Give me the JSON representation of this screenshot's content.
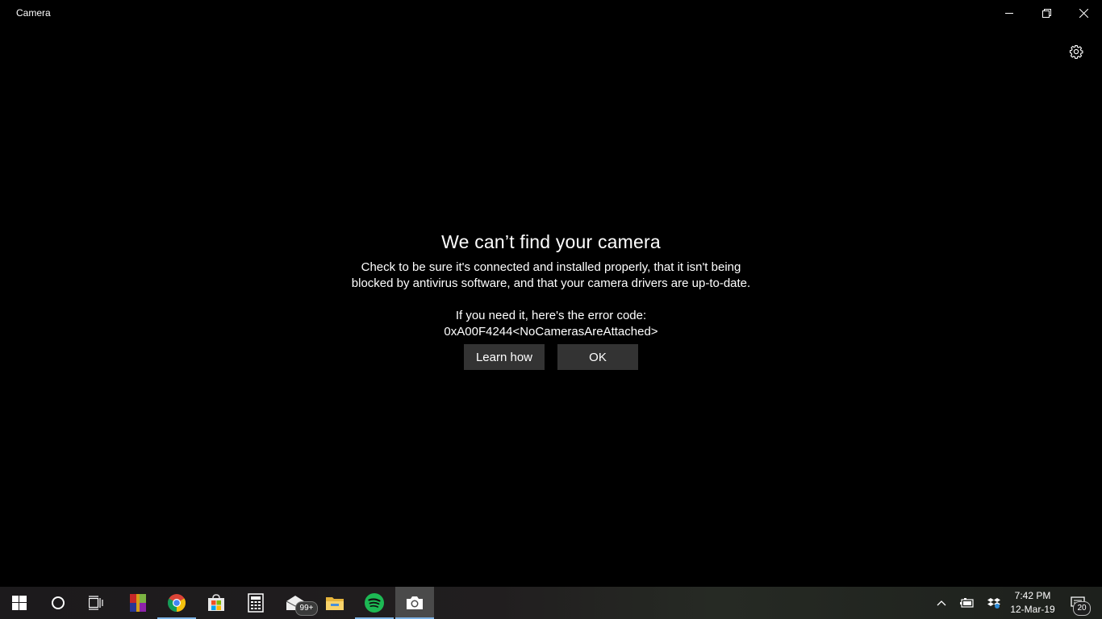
{
  "window": {
    "title": "Camera"
  },
  "dialog": {
    "title": "We can’t find your camera",
    "line1": "Check to be sure it's connected and installed properly, that it isn't being",
    "line2": "blocked by antivirus software, and that your camera drivers are up-to-date.",
    "line3": "If you need it, here's the error code:",
    "line4": "0xA00F4244<NoCamerasAreAttached>",
    "learn_how_label": "Learn how",
    "ok_label": "OK"
  },
  "taskbar": {
    "mail_badge": "99+",
    "clock_time": "7:42 PM",
    "clock_date": "12-Mar-19",
    "notification_count": "20",
    "pinned_icons": [
      "start-icon",
      "cortana-icon",
      "task-view-icon",
      "winrar-icon",
      "chrome-icon",
      "store-icon",
      "calculator-icon",
      "mail-icon",
      "file-explorer-icon",
      "spotify-icon",
      "camera-icon"
    ],
    "tray_icons": [
      "chevron-up-icon",
      "battery-icon",
      "dropbox-icon",
      "action-center-icon"
    ]
  },
  "colors": {
    "background": "#000000",
    "dialog_button": "#333333",
    "taskbar_active_underline": "#7eb4e6",
    "spotify_green": "#1db954"
  }
}
